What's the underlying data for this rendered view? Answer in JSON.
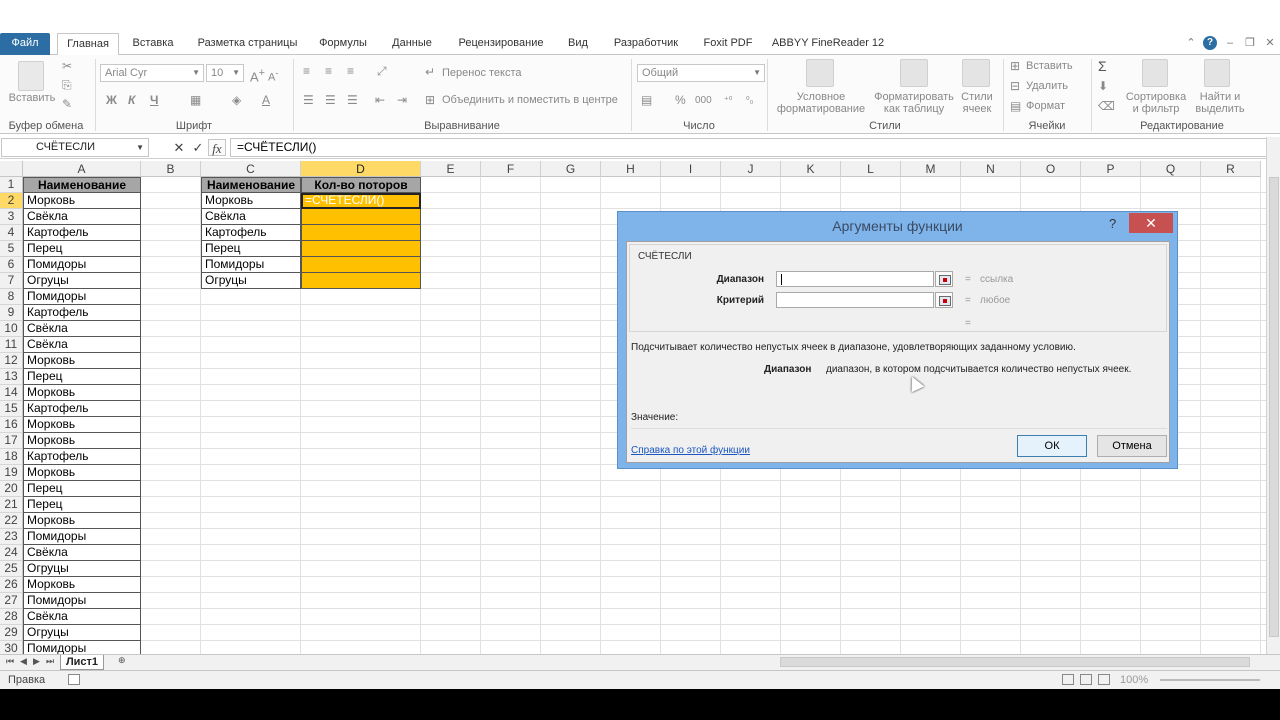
{
  "ribbon": {
    "tabs": [
      "Файл",
      "Главная",
      "Вставка",
      "Разметка страницы",
      "Формулы",
      "Данные",
      "Рецензирование",
      "Вид",
      "Разработчик",
      "Foxit PDF",
      "ABBYY FineReader 12"
    ],
    "clipboard": {
      "paste": "Вставить",
      "label": "Буфер обмена"
    },
    "font": {
      "name": "Arial Cyr",
      "size": "10",
      "bold": "Ж",
      "italic": "К",
      "underline": "Ч",
      "label": "Шрифт"
    },
    "alignment": {
      "wrap": "Перенос текста",
      "merge": "Объединить и поместить в центре",
      "label": "Выравнивание"
    },
    "number": {
      "format": "Общий",
      "percent": "%",
      "thousands": "000",
      "label": "Число"
    },
    "styles": {
      "conditional_1": "Условное",
      "conditional_2": "форматирование",
      "table_1": "Форматировать",
      "table_2": "как таблицу",
      "cell_1": "Стили",
      "cell_2": "ячеек",
      "label": "Стили"
    },
    "cells": {
      "insert": "Вставить",
      "delete": "Удалить",
      "format": "Формат",
      "label": "Ячейки"
    },
    "editing": {
      "sort_1": "Сортировка",
      "sort_2": "и фильтр",
      "find_1": "Найти и",
      "find_2": "выделить",
      "label": "Редактирование"
    }
  },
  "formula_bar": {
    "name_box": "СЧЁТЕСЛИ",
    "cancel": "✕",
    "enter": "✓",
    "fx": "fx",
    "formula": "=СЧЁТЕСЛИ()"
  },
  "sheet": {
    "columns": [
      "A",
      "B",
      "C",
      "D",
      "E",
      "F",
      "G",
      "H",
      "I",
      "J",
      "K",
      "L",
      "M",
      "N",
      "O",
      "P",
      "Q",
      "R"
    ],
    "rows": [
      "1",
      "2",
      "3",
      "4",
      "5",
      "6",
      "7",
      "8",
      "9",
      "10",
      "11",
      "12",
      "13",
      "14",
      "15",
      "16",
      "17",
      "18",
      "19",
      "20",
      "21",
      "22",
      "23",
      "24",
      "25",
      "26",
      "27",
      "28",
      "29",
      "30"
    ],
    "col_a": [
      "Наименование",
      "Морковь",
      "Свёкла",
      "Картофель",
      "Перец",
      "Помидоры",
      "Огруцы",
      "Помидоры",
      "Картофель",
      "Свёкла",
      "Свёкла",
      "Морковь",
      "Перец",
      "Морковь",
      "Картофель",
      "Морковь",
      "Морковь",
      "Картофель",
      "Морковь",
      "Перец",
      "Перец",
      "Морковь",
      "Помидоры",
      "Свёкла",
      "Огруцы",
      "Морковь",
      "Помидоры",
      "Свёкла",
      "Огруцы",
      "Помидоры"
    ],
    "col_c": [
      "Наименование",
      "Морковь",
      "Свёкла",
      "Картофель",
      "Перец",
      "Помидоры",
      "Огруцы"
    ],
    "col_d_header": "Кол-во поторов",
    "active_cell": "=СЧЁТЕСЛИ()",
    "tab_name": "Лист1"
  },
  "status": {
    "mode": "Правка",
    "zoom": "100%"
  },
  "dialog": {
    "title": "Аргументы функции",
    "help_glyph": "?",
    "close_glyph": "✕",
    "function_name": "СЧЁТЕСЛИ",
    "arg1_label": "Диапазон",
    "arg1_type": "ссылка",
    "arg2_label": "Критерий",
    "arg2_type": "любое",
    "eq": "=",
    "description": "Подсчитывает количество непустых ячеек в диапазоне, удовлетворяющих заданному условию.",
    "arg_help_name": "Диапазон",
    "arg_help_text": "диапазон, в котором подсчитывается количество непустых ячеек.",
    "value_label": "Значение:",
    "help_link": "Справка по этой функции",
    "ok": "ОК",
    "cancel": "Отмена"
  },
  "colors": {
    "accent": "#2c6ea3",
    "header_fill": "#a6a6a6",
    "highlight": "#ffc000",
    "dialog_frame": "#7eb4ea"
  }
}
